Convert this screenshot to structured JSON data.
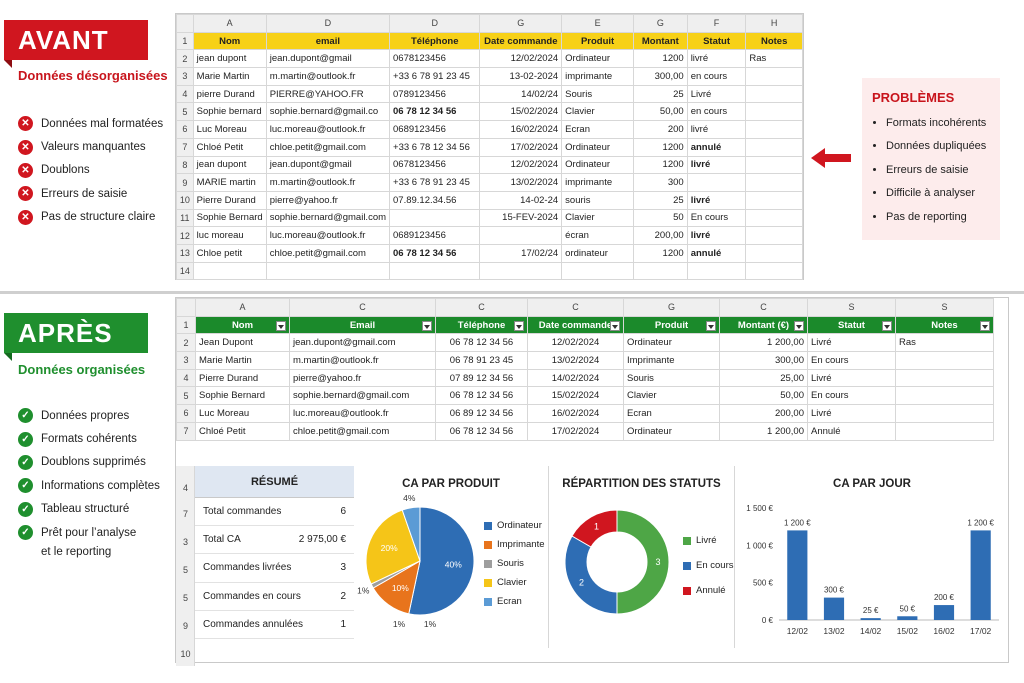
{
  "before": {
    "banner": "AVANT",
    "subtitle": "Données désorganisées",
    "bullets": [
      "Données mal formatées",
      "Valeurs manquantes",
      "Doublons",
      "Erreurs de saisie",
      "Pas de structure claire"
    ],
    "col_letters": [
      "A",
      "D",
      "D",
      "G",
      "E",
      "G",
      "F",
      "H"
    ],
    "headers": [
      "Nom",
      "email",
      "Téléphone",
      "Date commande",
      "Produit",
      "Montant",
      "Statut",
      "Notes"
    ],
    "rows": [
      [
        "jean dupont",
        "jean.dupont@gmail",
        "0678123456",
        "12/02/2024",
        "Ordinateur",
        "1200",
        "livré",
        "Ras"
      ],
      [
        "Marie Martin",
        "m.martin@outlook.fr",
        "+33 6 78 91 23 45",
        "13-02-2024",
        "imprimante",
        "300,00",
        "en cours",
        ""
      ],
      [
        "pierre Durand",
        "PIERRE@YAHOO.FR",
        "0789123456",
        "14/02/24",
        "Souris",
        "25",
        "Livré",
        ""
      ],
      [
        "Sophie bernard",
        "sophie.bernard@gmail.co",
        "06 78 12 34 56",
        "15/02/2024",
        "Clavier",
        "50,00",
        "en cours",
        ""
      ],
      [
        "Luc Moreau",
        "luc.moreau@outlook.fr",
        "0689123456",
        "16/02/2024",
        "Ecran",
        "200",
        "livré",
        ""
      ],
      [
        "Chloé Petit",
        "chloe.petit@gmail.com",
        "+33 6 78 12 34 56",
        "17/02/2024",
        "Ordinateur",
        "1200",
        "annulé",
        ""
      ],
      [
        "jean dupont",
        "jean.dupont@gmail",
        "0678123456",
        "12/02/2024",
        "Ordinateur",
        "1200",
        "livré",
        ""
      ],
      [
        "MARIE martin",
        "m.martin@outlook.fr",
        "+33 6 78 91 23 45",
        "13/02/2024",
        "imprimante",
        "300",
        "",
        ""
      ],
      [
        "Pierre Durand",
        "pierre@yahoo.fr",
        "07.89.12.34.56",
        "14-02-24",
        "souris",
        "25",
        "livré",
        ""
      ],
      [
        "Sophie Bernard",
        "sophie.bernard@gmail.com",
        "",
        "15-FEV-2024",
        "Clavier",
        "50",
        "En cours",
        ""
      ],
      [
        "luc moreau",
        "luc.moreau@outlook.fr",
        "0689123456",
        "",
        "écran",
        "200,00",
        "livré",
        ""
      ],
      [
        "Chloe petit",
        "chloe.petit@gmail.com",
        "06 78 12 34 56",
        "17/02/24",
        "ordinateur",
        "1200",
        "annulé",
        ""
      ],
      [
        "",
        "",
        "",
        "",
        "",
        "",
        "",
        ""
      ]
    ]
  },
  "problems": {
    "title": "PROBLÈMES",
    "items": [
      "Formats incohérents",
      "Données dupliquées",
      "Erreurs de saisie",
      "Difficile à analyser",
      "Pas de reporting"
    ]
  },
  "after": {
    "banner": "APRÈS",
    "subtitle": "Données organisées",
    "bullets": [
      "Données propres",
      "Formats cohérents",
      "Doublons supprimés",
      "Informations complètes",
      "Tableau structuré",
      "Prêt pour l’analyse",
      "et le reporting"
    ],
    "col_letters": [
      "A",
      "C",
      "C",
      "C",
      "G",
      "C",
      "S",
      "S"
    ],
    "headers": [
      "Nom",
      "Email",
      "Téléphone",
      "Date commande",
      "Produit",
      "Montant (€)",
      "Statut",
      "Notes"
    ],
    "rows": [
      [
        "Jean Dupont",
        "jean.dupont@gmail.com",
        "06 78 12 34 56",
        "12/02/2024",
        "Ordinateur",
        "1 200,00",
        "Livré",
        "Ras"
      ],
      [
        "Marie Martin",
        "m.martin@outlook.fr",
        "06 78 91 23 45",
        "13/02/2024",
        "Imprimante",
        "300,00",
        "En cours",
        ""
      ],
      [
        "Pierre Durand",
        "pierre@yahoo.fr",
        "07 89 12 34 56",
        "14/02/2024",
        "Souris",
        "25,00",
        "Livré",
        ""
      ],
      [
        "Sophie Bernard",
        "sophie.bernard@gmail.com",
        "06 78 12 34 56",
        "15/02/2024",
        "Clavier",
        "50,00",
        "En cours",
        ""
      ],
      [
        "Luc Moreau",
        "luc.moreau@outlook.fr",
        "06 89 12 34 56",
        "16/02/2024",
        "Ecran",
        "200,00",
        "Livré",
        ""
      ],
      [
        "Chloé Petit",
        "chloe.petit@gmail.com",
        "06 78 12 34 56",
        "17/02/2024",
        "Ordinateur",
        "1 200,00",
        "Annulé",
        ""
      ]
    ],
    "lower_row_numbers": [
      "4",
      "7",
      "3",
      "5",
      "5",
      "9",
      "10"
    ]
  },
  "resume": {
    "title": "RÉSUMÉ",
    "rows": [
      {
        "label": "Total commandes",
        "value": "6"
      },
      {
        "label": "Total CA",
        "value": "2 975,00 €"
      },
      {
        "label": "Commandes livrées",
        "value": "3"
      },
      {
        "label": "Commandes en cours",
        "value": "2"
      },
      {
        "label": "Commandes annulées",
        "value": "1"
      }
    ]
  },
  "chart_data": [
    {
      "type": "pie",
      "title": "CA PAR PRODUIT",
      "categories": [
        "Ordinateur",
        "Imprimante",
        "Souris",
        "Clavier",
        "Ecran"
      ],
      "values": [
        40,
        10,
        1,
        20,
        4
      ],
      "labels": [
        "40%",
        "10%",
        "1%",
        "20%",
        "4%"
      ],
      "extra_labels": [
        "1%",
        "1%"
      ],
      "colors": [
        "#2e6db4",
        "#e8741c",
        "#9e9e9e",
        "#f5c518",
        "#5b9bd5"
      ]
    },
    {
      "type": "pie",
      "title": "RÉPARTITION DES STATUTS",
      "categories": [
        "Livré",
        "En cours",
        "Annulé"
      ],
      "values": [
        3,
        2,
        1
      ],
      "colors": [
        "#4ea646",
        "#2e6db4",
        "#d0161f"
      ]
    },
    {
      "type": "bar",
      "title": "CA PAR JOUR",
      "categories": [
        "12/02",
        "13/02",
        "14/02",
        "15/02",
        "16/02",
        "17/02"
      ],
      "values": [
        1200,
        300,
        25,
        50,
        200,
        1200
      ],
      "labels": [
        "1 200 €",
        "300 €",
        "25 €",
        "50 €",
        "200 €",
        "1 200 €"
      ],
      "yticks": [
        "0 €",
        "500 €",
        "1 000 €",
        "1 500 €"
      ],
      "ylim": [
        0,
        1500
      ],
      "color": "#2e6db4"
    }
  ]
}
